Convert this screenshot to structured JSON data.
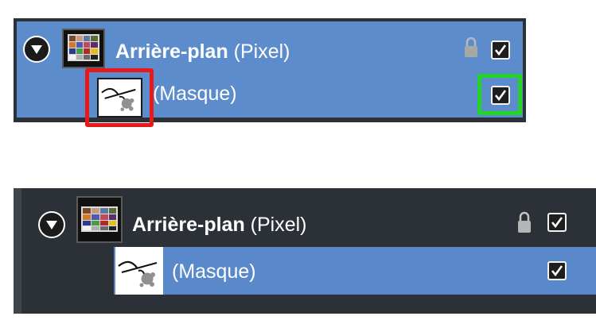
{
  "top_panel": {
    "layer": {
      "name": "Arrière-plan",
      "type": "(Pixel)",
      "locked": true,
      "visible": true
    },
    "mask": {
      "label": "(Masque)",
      "visible": true
    }
  },
  "bottom_panel": {
    "layer": {
      "name": "Arrière-plan",
      "type": "(Pixel)",
      "locked": true,
      "visible": true
    },
    "mask": {
      "label": "(Masque)",
      "visible": true
    }
  },
  "colors": {
    "selection_blue": "#5c8ccb",
    "panel_dark": "#2b3137",
    "highlight_red": "#e8191b",
    "highlight_green": "#22d423"
  },
  "icons": [
    "disclosure-triangle-icon",
    "color-checker-thumbnail",
    "mask-thumbnail",
    "lock-icon",
    "checkmark-icon"
  ]
}
